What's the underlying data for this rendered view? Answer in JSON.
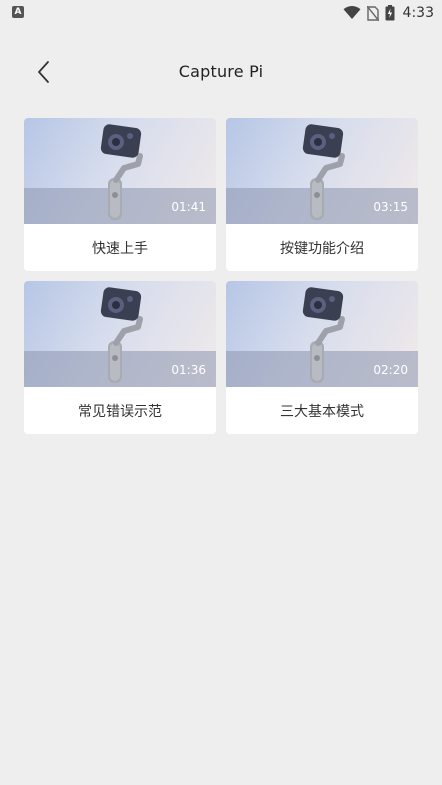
{
  "status_bar": {
    "left_icon": "A",
    "time": "4:33",
    "icons": [
      "wifi-icon",
      "no-sim-icon",
      "battery-icon"
    ]
  },
  "header": {
    "back_icon": "chevron-left-icon",
    "title": "Capture Pi"
  },
  "videos": [
    {
      "label": "快速上手",
      "duration": "01:41"
    },
    {
      "label": "按键功能介绍",
      "duration": "03:15"
    },
    {
      "label": "常见错误示范",
      "duration": "01:36"
    },
    {
      "label": "三大基本模式",
      "duration": "02:20"
    }
  ],
  "colors": {
    "background": "#eeeeee",
    "card": "#ffffff",
    "thumb_gradient_start": "#b6c6e6",
    "thumb_gradient_end": "#f1eaea"
  }
}
